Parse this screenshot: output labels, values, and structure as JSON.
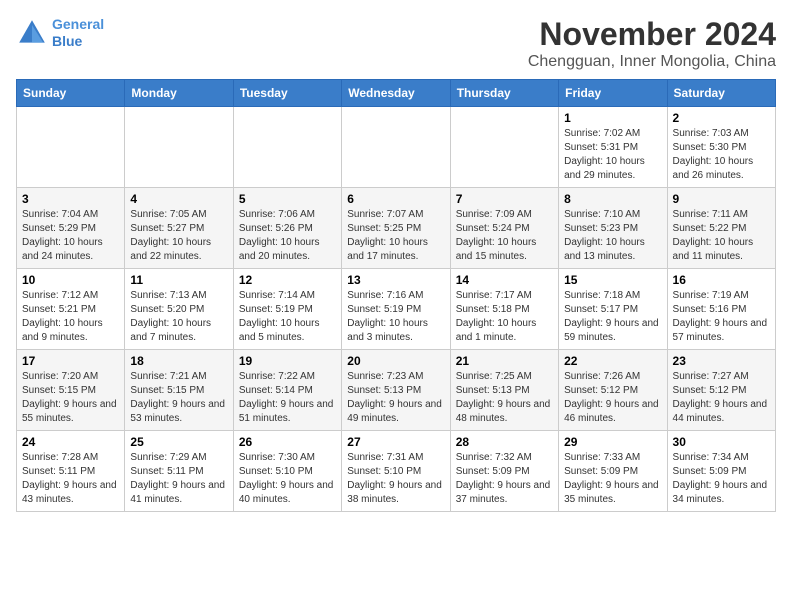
{
  "header": {
    "logo_line1": "General",
    "logo_line2": "Blue",
    "month_year": "November 2024",
    "location": "Chengguan, Inner Mongolia, China"
  },
  "weekdays": [
    "Sunday",
    "Monday",
    "Tuesday",
    "Wednesday",
    "Thursday",
    "Friday",
    "Saturday"
  ],
  "weeks": [
    [
      {
        "day": "",
        "info": ""
      },
      {
        "day": "",
        "info": ""
      },
      {
        "day": "",
        "info": ""
      },
      {
        "day": "",
        "info": ""
      },
      {
        "day": "",
        "info": ""
      },
      {
        "day": "1",
        "info": "Sunrise: 7:02 AM\nSunset: 5:31 PM\nDaylight: 10 hours and 29 minutes."
      },
      {
        "day": "2",
        "info": "Sunrise: 7:03 AM\nSunset: 5:30 PM\nDaylight: 10 hours and 26 minutes."
      }
    ],
    [
      {
        "day": "3",
        "info": "Sunrise: 7:04 AM\nSunset: 5:29 PM\nDaylight: 10 hours and 24 minutes."
      },
      {
        "day": "4",
        "info": "Sunrise: 7:05 AM\nSunset: 5:27 PM\nDaylight: 10 hours and 22 minutes."
      },
      {
        "day": "5",
        "info": "Sunrise: 7:06 AM\nSunset: 5:26 PM\nDaylight: 10 hours and 20 minutes."
      },
      {
        "day": "6",
        "info": "Sunrise: 7:07 AM\nSunset: 5:25 PM\nDaylight: 10 hours and 17 minutes."
      },
      {
        "day": "7",
        "info": "Sunrise: 7:09 AM\nSunset: 5:24 PM\nDaylight: 10 hours and 15 minutes."
      },
      {
        "day": "8",
        "info": "Sunrise: 7:10 AM\nSunset: 5:23 PM\nDaylight: 10 hours and 13 minutes."
      },
      {
        "day": "9",
        "info": "Sunrise: 7:11 AM\nSunset: 5:22 PM\nDaylight: 10 hours and 11 minutes."
      }
    ],
    [
      {
        "day": "10",
        "info": "Sunrise: 7:12 AM\nSunset: 5:21 PM\nDaylight: 10 hours and 9 minutes."
      },
      {
        "day": "11",
        "info": "Sunrise: 7:13 AM\nSunset: 5:20 PM\nDaylight: 10 hours and 7 minutes."
      },
      {
        "day": "12",
        "info": "Sunrise: 7:14 AM\nSunset: 5:19 PM\nDaylight: 10 hours and 5 minutes."
      },
      {
        "day": "13",
        "info": "Sunrise: 7:16 AM\nSunset: 5:19 PM\nDaylight: 10 hours and 3 minutes."
      },
      {
        "day": "14",
        "info": "Sunrise: 7:17 AM\nSunset: 5:18 PM\nDaylight: 10 hours and 1 minute."
      },
      {
        "day": "15",
        "info": "Sunrise: 7:18 AM\nSunset: 5:17 PM\nDaylight: 9 hours and 59 minutes."
      },
      {
        "day": "16",
        "info": "Sunrise: 7:19 AM\nSunset: 5:16 PM\nDaylight: 9 hours and 57 minutes."
      }
    ],
    [
      {
        "day": "17",
        "info": "Sunrise: 7:20 AM\nSunset: 5:15 PM\nDaylight: 9 hours and 55 minutes."
      },
      {
        "day": "18",
        "info": "Sunrise: 7:21 AM\nSunset: 5:15 PM\nDaylight: 9 hours and 53 minutes."
      },
      {
        "day": "19",
        "info": "Sunrise: 7:22 AM\nSunset: 5:14 PM\nDaylight: 9 hours and 51 minutes."
      },
      {
        "day": "20",
        "info": "Sunrise: 7:23 AM\nSunset: 5:13 PM\nDaylight: 9 hours and 49 minutes."
      },
      {
        "day": "21",
        "info": "Sunrise: 7:25 AM\nSunset: 5:13 PM\nDaylight: 9 hours and 48 minutes."
      },
      {
        "day": "22",
        "info": "Sunrise: 7:26 AM\nSunset: 5:12 PM\nDaylight: 9 hours and 46 minutes."
      },
      {
        "day": "23",
        "info": "Sunrise: 7:27 AM\nSunset: 5:12 PM\nDaylight: 9 hours and 44 minutes."
      }
    ],
    [
      {
        "day": "24",
        "info": "Sunrise: 7:28 AM\nSunset: 5:11 PM\nDaylight: 9 hours and 43 minutes."
      },
      {
        "day": "25",
        "info": "Sunrise: 7:29 AM\nSunset: 5:11 PM\nDaylight: 9 hours and 41 minutes."
      },
      {
        "day": "26",
        "info": "Sunrise: 7:30 AM\nSunset: 5:10 PM\nDaylight: 9 hours and 40 minutes."
      },
      {
        "day": "27",
        "info": "Sunrise: 7:31 AM\nSunset: 5:10 PM\nDaylight: 9 hours and 38 minutes."
      },
      {
        "day": "28",
        "info": "Sunrise: 7:32 AM\nSunset: 5:09 PM\nDaylight: 9 hours and 37 minutes."
      },
      {
        "day": "29",
        "info": "Sunrise: 7:33 AM\nSunset: 5:09 PM\nDaylight: 9 hours and 35 minutes."
      },
      {
        "day": "30",
        "info": "Sunrise: 7:34 AM\nSunset: 5:09 PM\nDaylight: 9 hours and 34 minutes."
      }
    ]
  ]
}
